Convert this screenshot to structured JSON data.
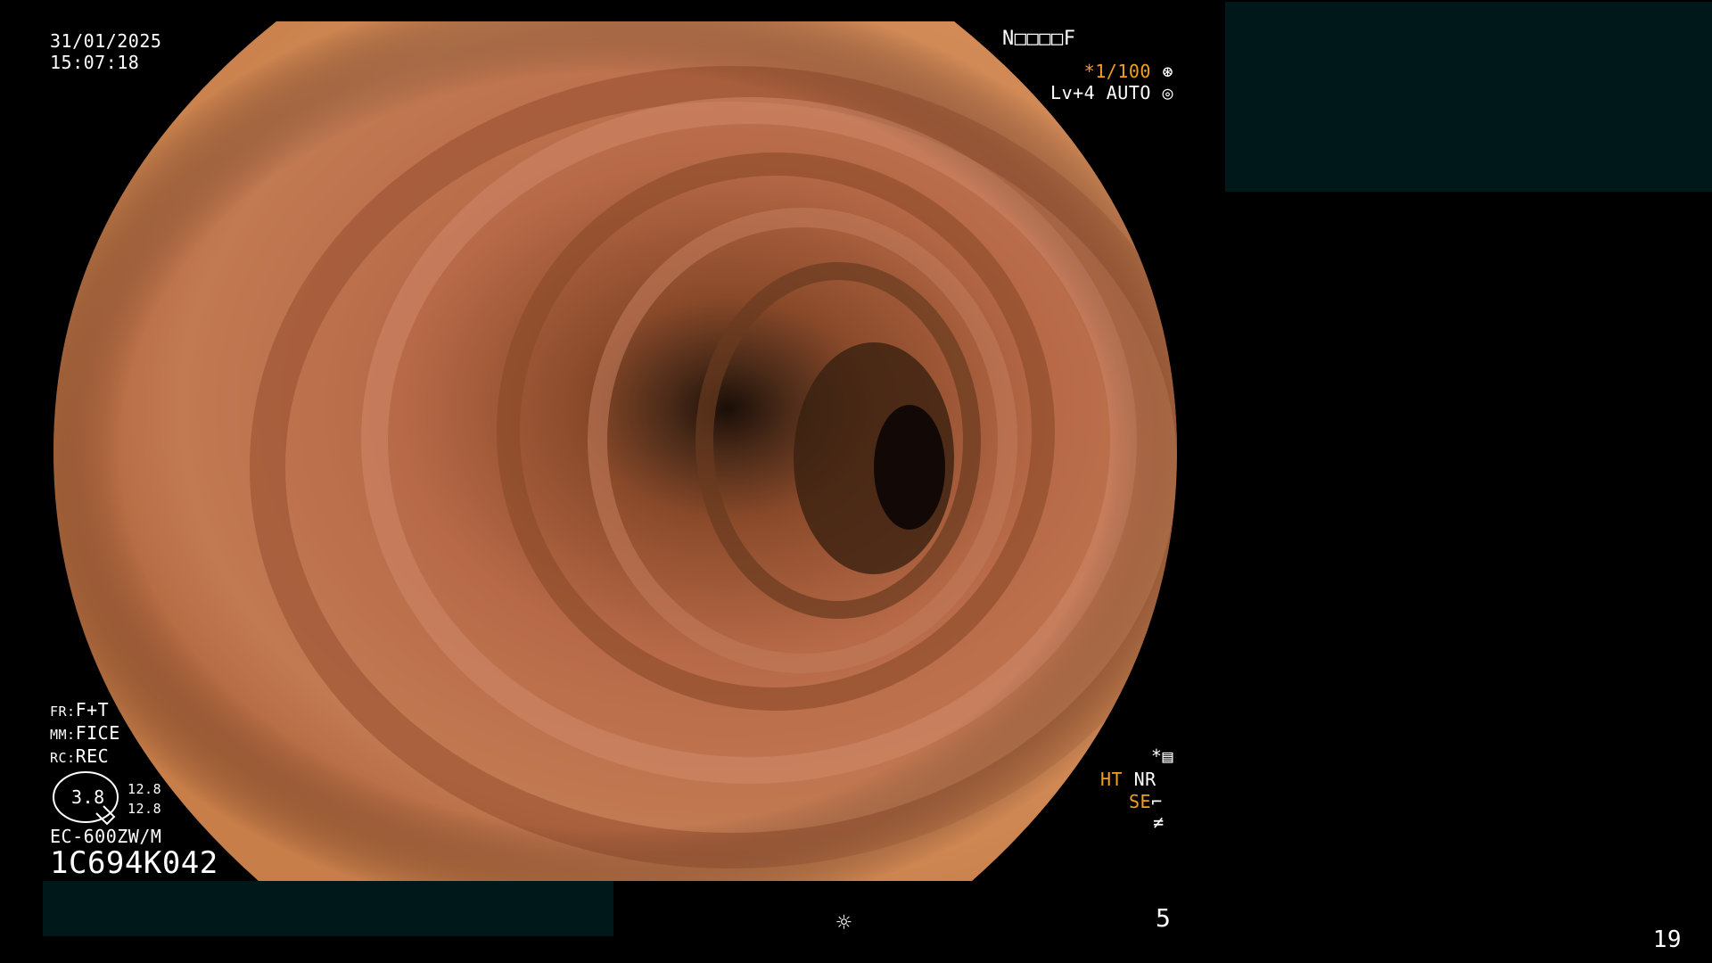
{
  "osd": {
    "date": "31/01/2025",
    "time": "15:07:18",
    "patient_code": "N□□□□F",
    "shutter": "*1/100",
    "level": "Lv+4 AUTO",
    "fr_key": "FR:",
    "fr_val": "F+T",
    "mm_key": "MM:",
    "mm_val": "FICE",
    "rc_key": "RC:",
    "rc_val": "REC",
    "zoom": "3.8",
    "zoom_a": "12.8",
    "zoom_b": "12.8",
    "scope_model": "EC-600ZW/M",
    "scope_serial": "1C694K042",
    "asterisk": "*",
    "ht": "HT",
    "nr": "NR",
    "se": "SE",
    "light_level": "5",
    "frame_number": "19"
  },
  "icons": {
    "shutter": "aperture-icon",
    "auto": "iris-icon",
    "memory": "memory-card-icon",
    "light": "sun-icon"
  },
  "colors": {
    "accent_orange": "#f0a020",
    "redaction_fill": "#01181a",
    "background": "#000000"
  }
}
